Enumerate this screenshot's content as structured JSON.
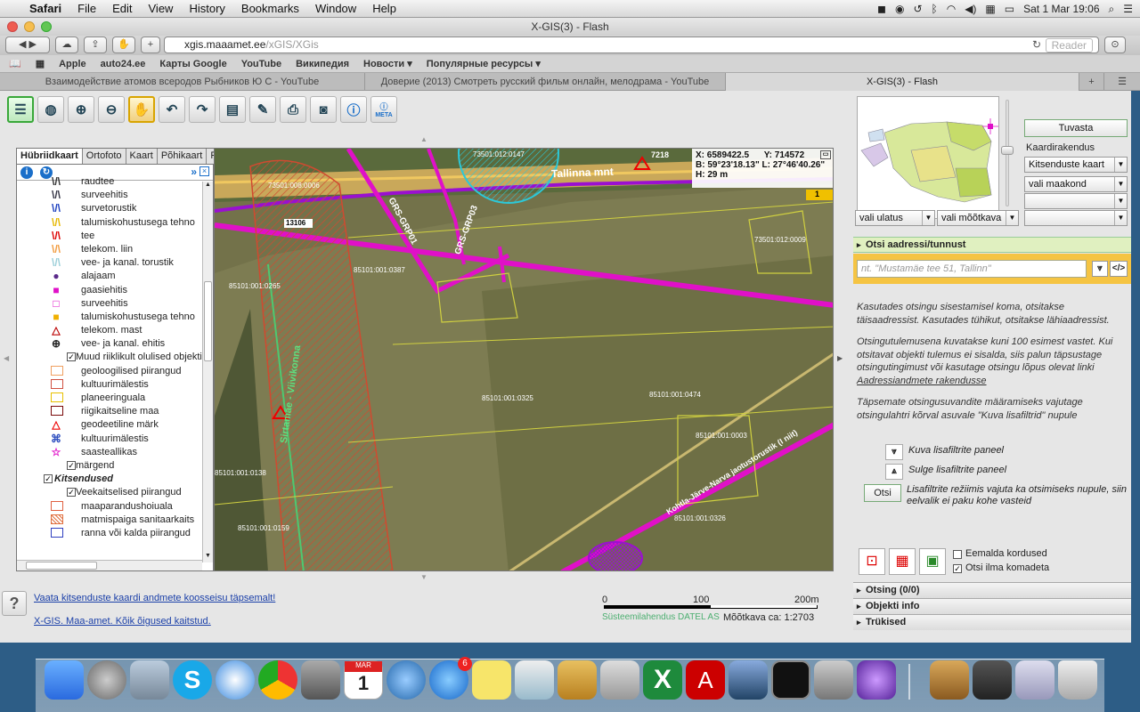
{
  "menubar": {
    "app": "Safari",
    "items": [
      "File",
      "Edit",
      "View",
      "History",
      "Bookmarks",
      "Window",
      "Help"
    ],
    "datetime": "Sat 1 Mar  19:06"
  },
  "window": {
    "title": "X-GIS(3) - Flash"
  },
  "url": {
    "host": "xgis.maaamet.ee",
    "path": "/xGIS/XGis",
    "reader": "Reader"
  },
  "bookmarks": [
    "Apple",
    "auto24.ee",
    "Карты Google",
    "YouTube",
    "Википедия",
    "Новости ▾",
    "Популярные ресурсы ▾"
  ],
  "tabs": [
    "Взаимодействие атомов всеродов Рыбников Ю С - YouTube",
    "Доверие (2013) Смотреть русский фильм онлайн, мелодрама - YouTube",
    "X-GIS(3) - Flash"
  ],
  "maptools": [
    "layers",
    "globe",
    "zoom-in",
    "zoom-out",
    "pan",
    "undo",
    "redo",
    "measure",
    "eraser",
    "print",
    "camera",
    "info",
    "info META"
  ],
  "leftpanel": {
    "tabs": [
      "Hübriidkaart",
      "Ortofoto",
      "Kaart",
      "Põhikaart",
      "Reljeef"
    ],
    "legend": [
      {
        "t": "sym",
        "sym": "\\/\\",
        "color": "#333",
        "label": "raudtee"
      },
      {
        "t": "sym",
        "sym": "\\/\\",
        "color": "#334",
        "label": "surveehitis"
      },
      {
        "t": "sym",
        "sym": "\\/\\",
        "color": "#1b3fbf",
        "label": "survetorustik"
      },
      {
        "t": "sym",
        "sym": "\\/\\",
        "color": "#e6b800",
        "label": "talumiskohustusega tehno"
      },
      {
        "t": "sym",
        "sym": "\\/\\",
        "color": "#d00",
        "label": "tee"
      },
      {
        "t": "sym",
        "sym": "\\/\\",
        "color": "#f29c40",
        "label": "telekom. liin"
      },
      {
        "t": "sym",
        "sym": "\\/\\",
        "color": "#9ccfd9",
        "label": "vee- ja kanal. torustik"
      },
      {
        "t": "sym",
        "sym": "●",
        "color": "#5a2a8a",
        "label": "alajaam"
      },
      {
        "t": "sym",
        "sym": "■",
        "color": "#e010c8",
        "label": "gaasiehitis"
      },
      {
        "t": "sym",
        "sym": "□",
        "color": "#e010c8",
        "label": "surveehitis"
      },
      {
        "t": "sym",
        "sym": "■",
        "color": "#f0b000",
        "label": "talumiskohustusega tehno"
      },
      {
        "t": "sym",
        "sym": "△",
        "color": "#b00",
        "label": "telekom. mast"
      },
      {
        "t": "sym",
        "sym": "⊕",
        "color": "#222",
        "label": "vee- ja kanal. ehitis"
      },
      {
        "t": "check",
        "label": "Muud riiklikult olulised objektid"
      },
      {
        "t": "box",
        "color": "#f0a060",
        "label": "geoloogilised piirangud"
      },
      {
        "t": "box",
        "color": "#d05040",
        "label": "kultuurimälestis"
      },
      {
        "t": "box",
        "color": "#e8c000",
        "label": "planeeringuala"
      },
      {
        "t": "box",
        "color": "#7a0a0a",
        "label": "riigikaitseline maa"
      },
      {
        "t": "sym",
        "sym": "△",
        "color": "#e00",
        "label": "geodeetiline märk"
      },
      {
        "t": "sym",
        "sym": "⌘",
        "color": "#3050c0",
        "label": "kultuurimälestis"
      },
      {
        "t": "sym",
        "sym": "☆",
        "color": "#e010c8",
        "label": "saasteallikas"
      },
      {
        "t": "check",
        "label": "märgend"
      },
      {
        "t": "checkb",
        "label": "Kitsendused"
      },
      {
        "t": "check",
        "label": "Veekaitselised piirangud"
      },
      {
        "t": "box",
        "color": "#e06040",
        "label": "maaparandushoiuala"
      },
      {
        "t": "hatch",
        "color": "#e07040",
        "label": "matmispaiga sanitaarkaits"
      },
      {
        "t": "box",
        "color": "#3040c0",
        "label": "ranna või kalda piirangud"
      }
    ]
  },
  "map": {
    "coords": {
      "x": "X: 6589422.5",
      "y": "Y: 714572",
      "b": "B: 59°23'18.13\"",
      "l": "L: 27°46'40.26\"",
      "h": "H: 29 m"
    },
    "labels": [
      "73501:012:0147",
      "7218",
      "Tallinna mnt",
      "73501:008:0006",
      "13106",
      "85101:001:0387",
      "85101:001:0265",
      "GRS-GRP01",
      "GRS-GRP03",
      "73501:012:0009",
      "Sirtamäe - Viivikonna",
      "85101:001:0325",
      "85101:001:0474",
      "85101:001:0003",
      "85101:001:0138",
      "85101:001:0326",
      "85101:001:0159",
      "Kohtla-Järve-Narva jaotustorustik (I niit)",
      "1"
    ]
  },
  "rightpanel": {
    "tuvasta": "Tuvasta",
    "kaardirakendus_label": "Kaardirakendus",
    "kaardirakendus_value": "Kitsenduste kaart",
    "maakond": "vali maakond",
    "ulatus": "vali ulatus",
    "mootkava": "vali mõõtkava",
    "search_header": "Otsi aadressi/tunnust",
    "search_placeholder": "nt. \"Mustamäe tee 51, Tallinn\"",
    "help": [
      "Kasutades otsingu sisestamisel koma, otsitakse täisaadressist. Kasutades tühikut, otsitakse lähiaadressist.",
      "Otsingutulemusena kuvatakse kuni 100 esimest vastet. Kui otsitavat objekti tulemus ei sisalda, siis palun täpsustage otsingutingimust või kasutage otsingu lõpus olevat linki",
      "Aadressiandmete rakendusse",
      "Täpsemate otsingusuvandite määramiseks vajutage otsingulahtri kõrval asuvale \"Kuva lisafiltrid\" nupule"
    ],
    "show_filters": "Kuva lisafiltrite paneel",
    "hide_filters": "Sulge lisafiltrite paneel",
    "otsi": "Otsi",
    "otsi_desc": "Lisafiltrite režiimis vajuta ka otsimiseks nupule, siin eelvalik ei paku kohe vasteid",
    "remove_dupes": "Eemalda kordused",
    "no_commas": "Otsi ilma komadeta",
    "accordion": [
      "Otsing (0/0)",
      "Objekti info",
      "Trükised"
    ]
  },
  "bottom": {
    "link1": "Vaata kitsenduste kaardi andmete koosseisu täpsemalt!",
    "link2": "X-GIS. Maa-amet. Kõik õigused kaitstud.",
    "credit": "Süsteemilahendus DATEL AS",
    "scale_text": "Mõõtkava ca: 1:2703",
    "scale_ticks": [
      "0",
      "100",
      "200m"
    ]
  },
  "dock": {
    "badge": "6",
    "cal_month": "MAR",
    "cal_day": "1"
  },
  "colors": {
    "accent": "#39a839",
    "search": "#f5c443",
    "pipe": "#9a10d0",
    "magenta": "#e010c8"
  }
}
